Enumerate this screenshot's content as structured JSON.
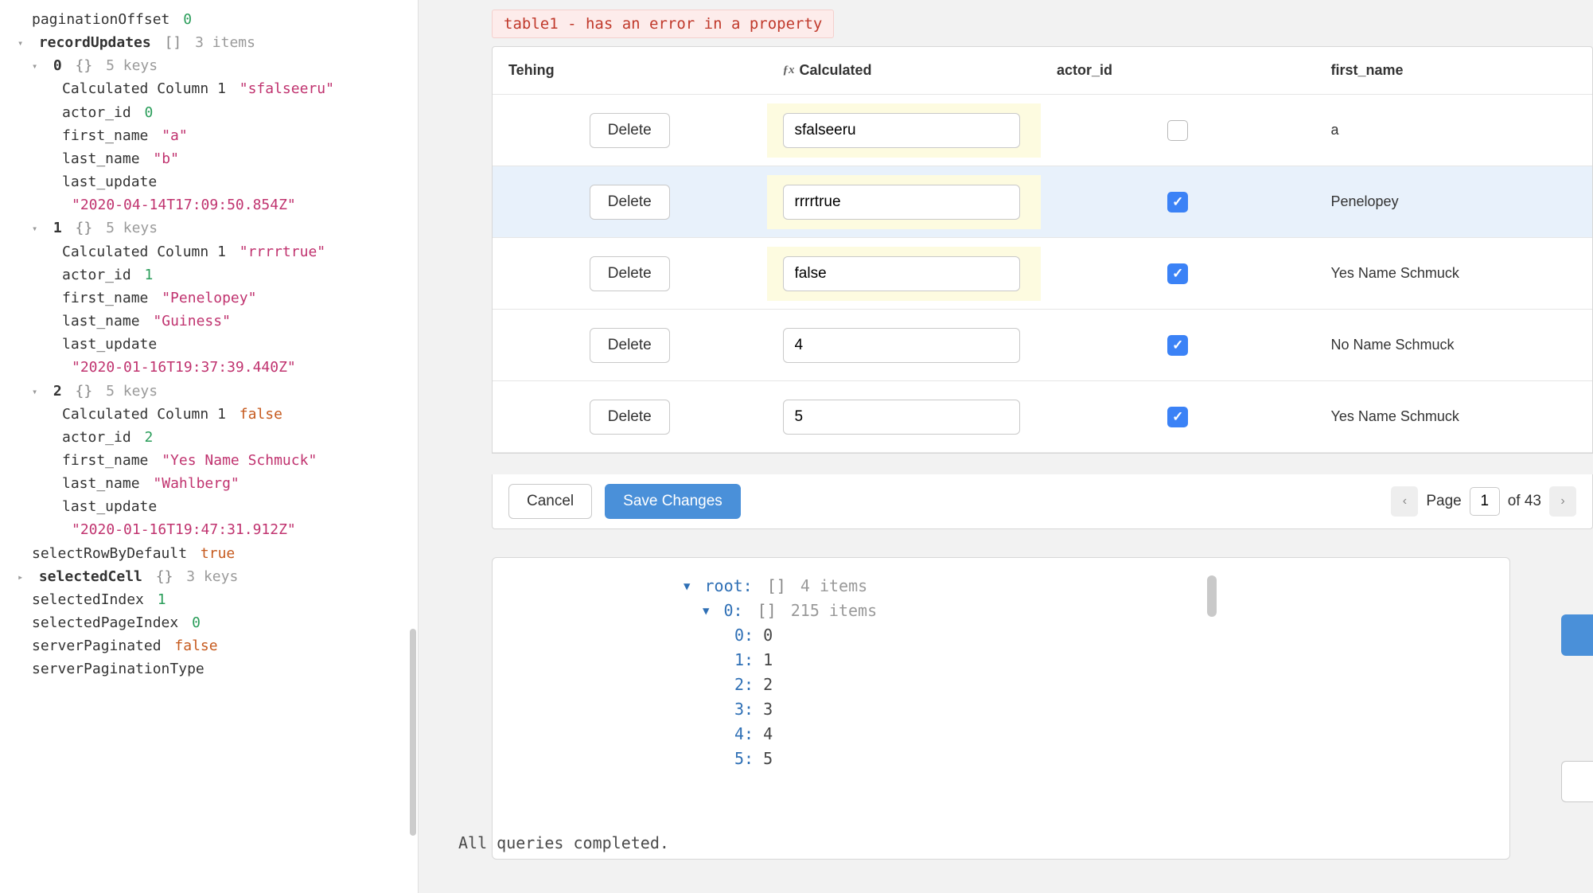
{
  "sidebar": {
    "paginationOffset": {
      "key": "paginationOffset",
      "value": "0"
    },
    "recordUpdates": {
      "key": "recordUpdates",
      "brackets": "[]",
      "meta": "3 items",
      "items": [
        {
          "idx": "0",
          "brackets": "{}",
          "meta": "5 keys",
          "calc": {
            "k": "Calculated Column 1",
            "v": "\"sfalseeru\""
          },
          "actor": {
            "k": "actor_id",
            "v": "0"
          },
          "first": {
            "k": "first_name",
            "v": "\"a\""
          },
          "last": {
            "k": "last_name",
            "v": "\"b\""
          },
          "upd_k": "last_update",
          "upd_v": "\"2020-04-14T17:09:50.854Z\""
        },
        {
          "idx": "1",
          "brackets": "{}",
          "meta": "5 keys",
          "calc": {
            "k": "Calculated Column 1",
            "v": "\"rrrrtrue\""
          },
          "actor": {
            "k": "actor_id",
            "v": "1"
          },
          "first": {
            "k": "first_name",
            "v": "\"Penelopey\""
          },
          "last": {
            "k": "last_name",
            "v": "\"Guiness\""
          },
          "upd_k": "last_update",
          "upd_v": "\"2020-01-16T19:37:39.440Z\""
        },
        {
          "idx": "2",
          "brackets": "{}",
          "meta": "5 keys",
          "calc": {
            "k": "Calculated Column 1",
            "v": "false",
            "bool": true
          },
          "actor": {
            "k": "actor_id",
            "v": "2"
          },
          "first": {
            "k": "first_name",
            "v": "\"Yes Name Schmuck\""
          },
          "last": {
            "k": "last_name",
            "v": "\"Wahlberg\""
          },
          "upd_k": "last_update",
          "upd_v": "\"2020-01-16T19:47:31.912Z\""
        }
      ]
    },
    "selectRowByDefault": {
      "key": "selectRowByDefault",
      "value": "true"
    },
    "selectedCell": {
      "key": "selectedCell",
      "brackets": "{}",
      "meta": "3 keys"
    },
    "selectedIndex": {
      "key": "selectedIndex",
      "value": "1"
    },
    "selectedPageIndex": {
      "key": "selectedPageIndex",
      "value": "0"
    },
    "serverPaginated": {
      "key": "serverPaginated",
      "value": "false"
    },
    "serverPaginationType": {
      "key": "serverPaginationType"
    }
  },
  "errorChip": "table1 - has an error in a property",
  "table": {
    "headers": {
      "tehing": "Tehing",
      "calc_prefix": "ƒx",
      "calc": "Calculated",
      "actor": "actor_id",
      "first": "first_name"
    },
    "rows": [
      {
        "delete": "Delete",
        "calc": "sfalseeru",
        "checked": false,
        "first": "a",
        "dirty": true,
        "selected": false
      },
      {
        "delete": "Delete",
        "calc": "rrrrtrue",
        "checked": true,
        "first": "Penelopey",
        "dirty": true,
        "selected": true
      },
      {
        "delete": "Delete",
        "calc": "false",
        "checked": true,
        "first": "Yes Name Schmuck",
        "dirty": true,
        "selected": false
      },
      {
        "delete": "Delete",
        "calc": "4",
        "checked": true,
        "first": "No Name Schmuck",
        "dirty": false,
        "selected": false
      },
      {
        "delete": "Delete",
        "calc": "5",
        "checked": true,
        "first": "Yes Name Schmuck",
        "dirty": false,
        "selected": false
      }
    ],
    "footer": {
      "cancel": "Cancel",
      "save": "Save Changes",
      "pageLabel": "Page",
      "pageValue": "1",
      "ofLabel": "of 43"
    }
  },
  "jsonPanel": {
    "root": {
      "key": "root:",
      "br": "[]",
      "meta": "4 items"
    },
    "zero": {
      "key": "0:",
      "br": "[]",
      "meta": "215 items"
    },
    "rows": [
      {
        "k": "0:",
        "v": "0"
      },
      {
        "k": "1:",
        "v": "1"
      },
      {
        "k": "2:",
        "v": "2"
      },
      {
        "k": "3:",
        "v": "3"
      },
      {
        "k": "4:",
        "v": "4"
      },
      {
        "k": "5:",
        "v": "5"
      }
    ]
  },
  "statusBar": "All queries completed."
}
